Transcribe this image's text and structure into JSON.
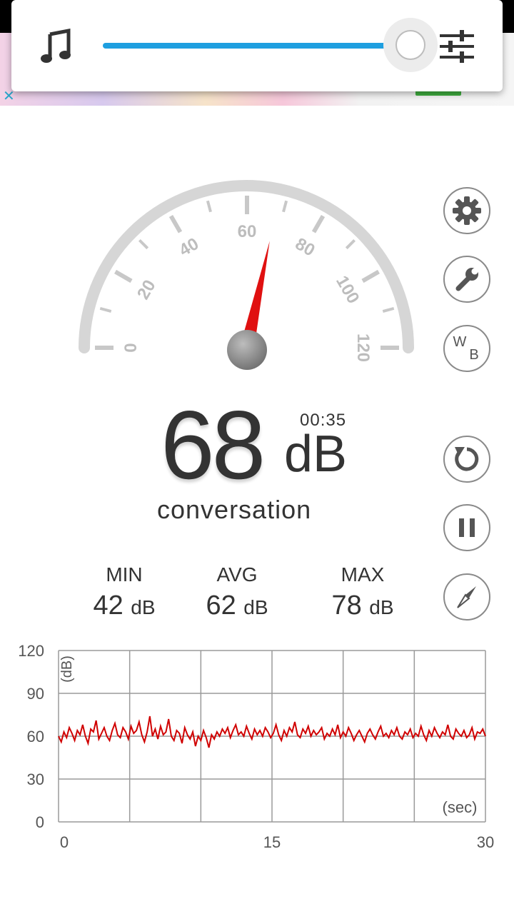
{
  "volume_popup": {
    "icon": "music-note-icon",
    "settings_icon": "equalizer-sliders-icon",
    "level": 0.96
  },
  "meter": {
    "value": "68",
    "unit": "dB",
    "timer": "00:35",
    "description": "conversation",
    "needle_value": 68,
    "scale_labels": [
      "0",
      "20",
      "40",
      "60",
      "80",
      "100",
      "120"
    ]
  },
  "stats": [
    {
      "label": "MIN",
      "value": "42",
      "unit": "dB"
    },
    {
      "label": "AVG",
      "value": "62",
      "unit": "dB"
    },
    {
      "label": "MAX",
      "value": "78",
      "unit": "dB"
    }
  ],
  "side_buttons": [
    "settings-gear-icon",
    "wrench-icon",
    "wb-icon",
    "reset-icon",
    "pause-icon",
    "compass-icon"
  ],
  "side_button_text": {
    "wb_w": "W",
    "wb_b": "B"
  },
  "colors": {
    "needle": "#e01010",
    "series": "#d00000",
    "slider": "#1e9fe0",
    "grid": "#9a9a9a"
  },
  "chart_data": {
    "type": "line",
    "ylabel": "(dB)",
    "xlabel": "(sec)",
    "xlim": [
      0,
      30
    ],
    "ylim": [
      0,
      120
    ],
    "x_tick_labels": [
      "0",
      "15",
      "30"
    ],
    "y_tick_labels": [
      "120",
      "90",
      "60",
      "30",
      "0"
    ],
    "series": [
      {
        "values": [
          60,
          56,
          63,
          59,
          66,
          62,
          57,
          64,
          61,
          68,
          60,
          55,
          65,
          63,
          71,
          58,
          62,
          66,
          60,
          57,
          64,
          69,
          61,
          59,
          66,
          63,
          58,
          67,
          62,
          64,
          70,
          61,
          56,
          63,
          74,
          60,
          65,
          58,
          67,
          61,
          63,
          72,
          60,
          57,
          64,
          62,
          55,
          66,
          61,
          58,
          63,
          53,
          60,
          57,
          64,
          59,
          52,
          61,
          58,
          63,
          60,
          65,
          62,
          66,
          59,
          64,
          68,
          61,
          63,
          60,
          67,
          62,
          58,
          65,
          61,
          64,
          60,
          66,
          63,
          59,
          62,
          68,
          61,
          57,
          64,
          60,
          66,
          63,
          70,
          61,
          59,
          65,
          62,
          67,
          60,
          64,
          61,
          63,
          66,
          58,
          62,
          60,
          65,
          61,
          68,
          59,
          63,
          60,
          66,
          62,
          57,
          61,
          64,
          60,
          56,
          62,
          65,
          61,
          58,
          63,
          67,
          60,
          62,
          59,
          64,
          61,
          66,
          60,
          58,
          63,
          61,
          65,
          59,
          62,
          60,
          67,
          61,
          57,
          64,
          60,
          66,
          62,
          59,
          63,
          61,
          68,
          60,
          58,
          65,
          62,
          60,
          64,
          59,
          61,
          66,
          58,
          63,
          62,
          65,
          60
        ]
      }
    ]
  }
}
